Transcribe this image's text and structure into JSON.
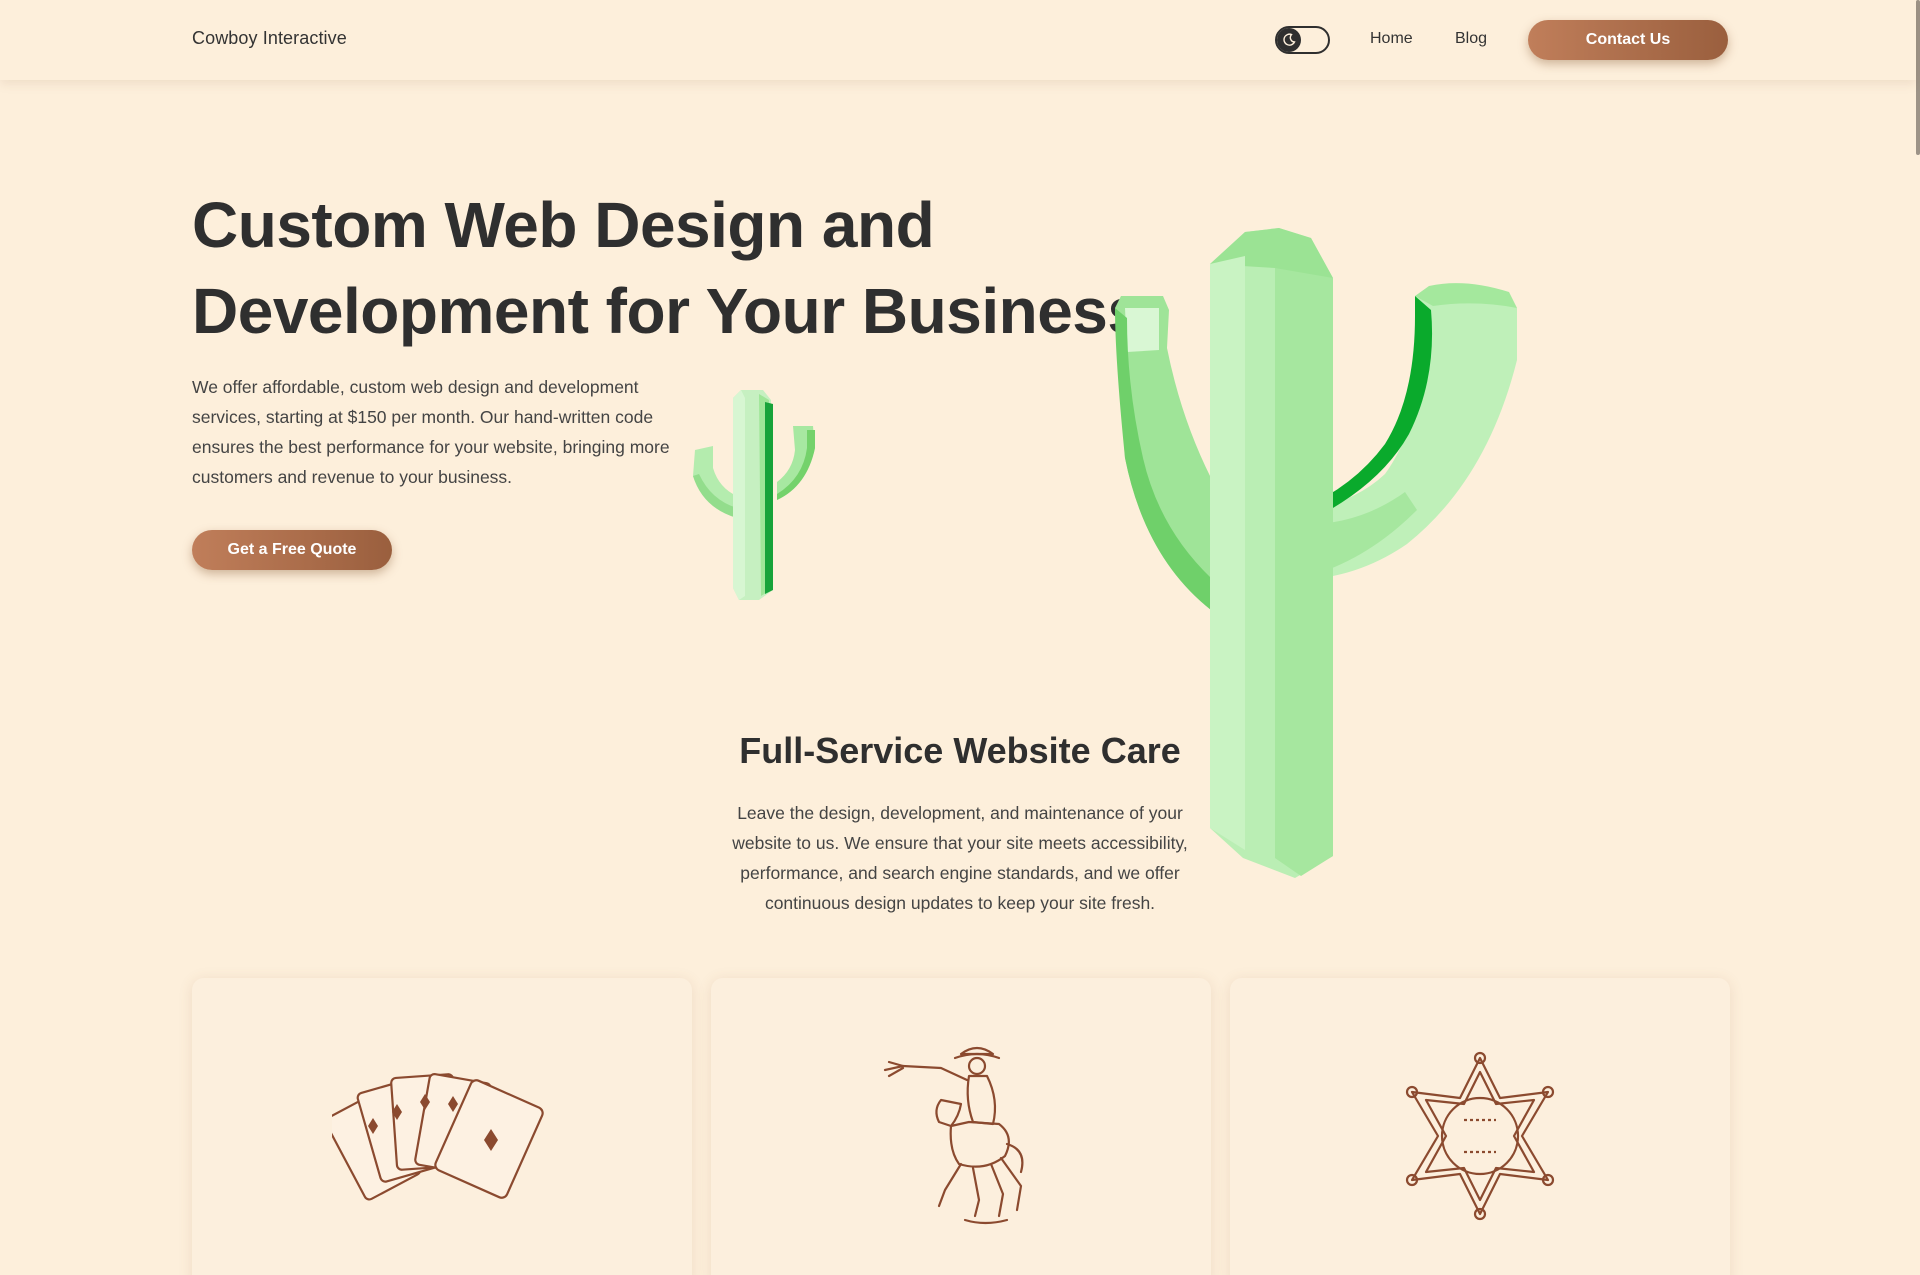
{
  "header": {
    "brand": "Cowboy Interactive",
    "nav": {
      "home": "Home",
      "blog": "Blog"
    },
    "contact_label": "Contact Us",
    "theme_toggle_icon": "moon-icon"
  },
  "hero": {
    "title_line1": "Custom Web Design and",
    "title_line2": "Development for Your Business",
    "description": "We offer affordable, custom web design and development services, starting at $150 per month. Our hand-written code ensures the best performance for your website, bringing more customers and revenue to your business.",
    "cta_label": "Get a Free Quote"
  },
  "services": {
    "title": "Full-Service Website Care",
    "description": "Leave the design, development, and maintenance of your website to us. We ensure that your site meets accessibility, performance, and search engine standards, and we offer continuous design updates to keep your site fresh.",
    "cards": [
      {
        "icon": "playing-cards-icon"
      },
      {
        "icon": "cowboy-rider-icon"
      },
      {
        "icon": "sheriff-badge-icon"
      }
    ]
  },
  "colors": {
    "background": "#fdefdb",
    "accent": "#b06f4b",
    "text": "#2f2f2f",
    "cactus": "#a6e9a2",
    "illustration": "#8b4a2f"
  }
}
